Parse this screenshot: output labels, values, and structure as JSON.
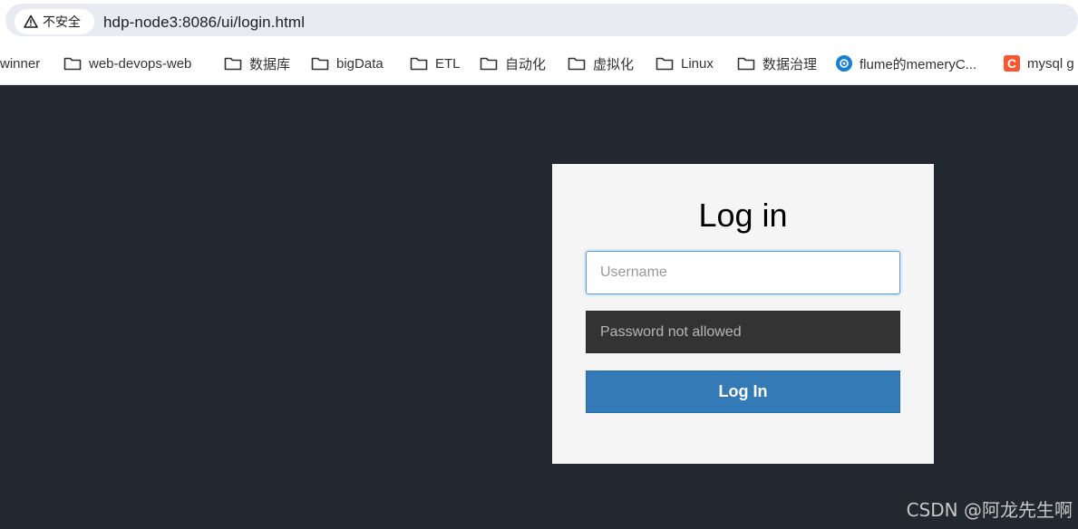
{
  "browser": {
    "security_label": "不安全",
    "url": "hdp-node3:8086/ui/login.html"
  },
  "bookmarks": [
    {
      "label": "winner",
      "icon": "none"
    },
    {
      "label": "web-devops-web",
      "icon": "folder-icon"
    },
    {
      "label": "数据库",
      "icon": "folder-icon"
    },
    {
      "label": "bigData",
      "icon": "folder-icon"
    },
    {
      "label": "ETL",
      "icon": "folder-icon"
    },
    {
      "label": "自动化",
      "icon": "folder-icon"
    },
    {
      "label": "虚拟化",
      "icon": "folder-icon"
    },
    {
      "label": "Linux",
      "icon": "folder-icon"
    },
    {
      "label": "数据治理",
      "icon": "folder-icon"
    },
    {
      "label": "flume的memeryC...",
      "icon": "site-icon"
    },
    {
      "label": "mysql g",
      "icon": "csdn-icon"
    }
  ],
  "login": {
    "title": "Log in",
    "username_placeholder": "Username",
    "username_value": "",
    "password_placeholder": "Password not allowed",
    "button_label": "Log In"
  },
  "watermark": "CSDN @阿龙先生啊",
  "colors": {
    "page_background": "#232730",
    "card_background": "#f5f5f5",
    "button_primary": "#337ab7",
    "password_field": "#333333"
  }
}
